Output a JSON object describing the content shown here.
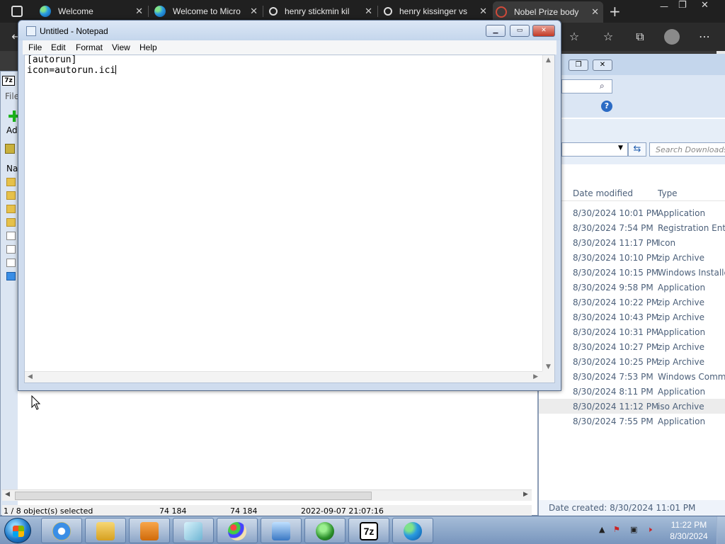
{
  "browser": {
    "tabs": [
      {
        "label": "Welcome",
        "icon": "edge-icon"
      },
      {
        "label": "Welcome to Micro",
        "icon": "edge-icon"
      },
      {
        "label": "henry stickmin kil",
        "icon": "search-icon"
      },
      {
        "label": "henry kissinger vs",
        "icon": "search-icon"
      },
      {
        "label": "Nobel Prize body",
        "icon": "nobel-icon"
      }
    ],
    "new_tab": "+",
    "window_min": "—",
    "window_max": "❐",
    "window_close": "✕"
  },
  "sevenzip": {
    "logo": "7z",
    "file_menu": "File",
    "add_label": "Ad",
    "name_col": "Na",
    "status": {
      "selected": "1 / 8 object(s) selected",
      "size1": "74 184",
      "size2": "74 184",
      "modified": "2022-09-07 21:07:16"
    }
  },
  "explorer": {
    "search_placeholder": "Search Downloads",
    "columns": {
      "date": "Date modified",
      "type": "Type"
    },
    "rows": [
      {
        "date": "8/30/2024 10:01 PM",
        "type": "Application"
      },
      {
        "date": "8/30/2024 7:54 PM",
        "type": "Registration Entries"
      },
      {
        "date": "8/30/2024 11:17 PM",
        "type": "Icon"
      },
      {
        "date": "8/30/2024 10:10 PM",
        "type": "zip Archive"
      },
      {
        "date": "8/30/2024 10:15 PM",
        "type": "Windows Installer"
      },
      {
        "date": "8/30/2024 9:58 PM",
        "type": "Application"
      },
      {
        "date": "8/30/2024 10:22 PM",
        "type": "zip Archive"
      },
      {
        "date": "8/30/2024 10:43 PM",
        "type": "zip Archive"
      },
      {
        "date": "8/30/2024 10:31 PM",
        "type": "Application"
      },
      {
        "date": "8/30/2024 10:27 PM",
        "type": "zip Archive"
      },
      {
        "date": "8/30/2024 10:25 PM",
        "type": "zip Archive"
      },
      {
        "date": "8/30/2024 7:53 PM",
        "type": "Windows Command"
      },
      {
        "date": "8/30/2024 8:11 PM",
        "type": "Application"
      },
      {
        "date": "8/30/2024 11:12 PM",
        "type": "iso Archive"
      },
      {
        "date": "8/30/2024 7:55 PM",
        "type": "Application"
      }
    ],
    "footer": "Date created: 8/30/2024 11:01 PM"
  },
  "notepad": {
    "title": "Untitled - Notepad",
    "menu": [
      "File",
      "Edit",
      "Format",
      "View",
      "Help"
    ],
    "line1": "[autorun]",
    "line2": "icon=autorun.ici"
  },
  "taskbar": {
    "apps": [
      "internet-explorer-icon",
      "windows-explorer-icon",
      "media-player-icon",
      "tablet-icon",
      "paint-icon",
      "network-icon",
      "windows-orb-icon",
      "7zip-icon",
      "edge-icon"
    ],
    "sevenzip_label": "7z",
    "clock_time": "11:22 PM",
    "clock_date": "8/30/2024"
  },
  "colors": {
    "browser_chrome": "#202020",
    "notepad_frame": "#cfdcee",
    "taskbar": "#7895bd",
    "explorer_text": "#4c607a"
  }
}
